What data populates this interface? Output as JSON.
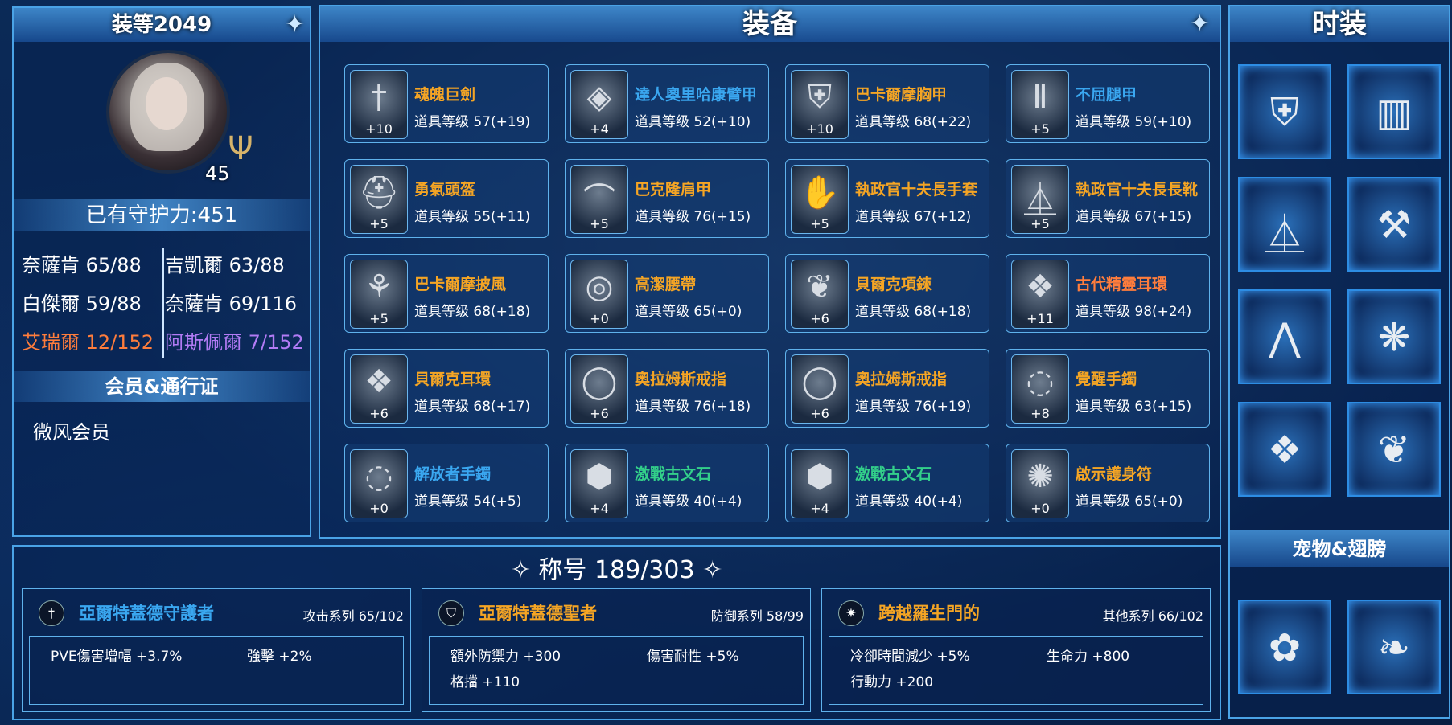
{
  "left": {
    "header": "装等2049",
    "level": "45",
    "guard": "已有守护力:451",
    "stats": [
      {
        "label": "奈薩肯 65/88",
        "color": "#ffffff"
      },
      {
        "label": "吉凱爾 63/88",
        "color": "#ffffff"
      },
      {
        "label": "白傑爾 59/88",
        "color": "#ffffff"
      },
      {
        "label": "奈薩肯 69/116",
        "color": "#ffffff"
      },
      {
        "label": "艾瑞爾 12/152",
        "color": "#ff7d3c"
      },
      {
        "label": "阿斯佩爾 7/152",
        "color": "#b27bf5"
      }
    ],
    "member_header": "会员&通行证",
    "member": "微风会员"
  },
  "equip": {
    "header": "装备",
    "items": [
      {
        "name": "魂魄巨劍",
        "level": "道具等级 57(+19)",
        "plus": "+10",
        "icon": "sword-icon",
        "color": "#f5a524"
      },
      {
        "name": "達人奧里哈康臂甲",
        "level": "道具等级 52(+10)",
        "plus": "+4",
        "icon": "vambrace-icon",
        "color": "#3aa7f0"
      },
      {
        "name": "巴卡爾摩胸甲",
        "level": "道具等级 68(+22)",
        "plus": "+10",
        "icon": "chest-armor-icon",
        "color": "#f5a524"
      },
      {
        "name": "不屈腿甲",
        "level": "道具等级 59(+10)",
        "plus": "+5",
        "icon": "leg-armor-icon",
        "color": "#3aa7f0"
      },
      {
        "name": "勇氣頭盔",
        "level": "道具等级 55(+11)",
        "plus": "+5",
        "icon": "helmet-icon",
        "color": "#f5a524"
      },
      {
        "name": "巴克隆肩甲",
        "level": "道具等级 76(+15)",
        "plus": "+5",
        "icon": "shoulder-icon",
        "color": "#f5a524"
      },
      {
        "name": "執政官十夫長手套",
        "level": "道具等级 67(+12)",
        "plus": "+5",
        "icon": "gloves-icon",
        "color": "#f5a524"
      },
      {
        "name": "執政官十夫長長靴",
        "level": "道具等级 67(+15)",
        "plus": "+5",
        "icon": "boots-icon",
        "color": "#f5a524"
      },
      {
        "name": "巴卡爾摩披風",
        "level": "道具等级 68(+18)",
        "plus": "+5",
        "icon": "cape-icon",
        "color": "#f5a524"
      },
      {
        "name": "高潔腰帶",
        "level": "道具等级 65(+0)",
        "plus": "+0",
        "icon": "belt-icon",
        "color": "#f5a524"
      },
      {
        "name": "貝爾克項鍊",
        "level": "道具等级 68(+18)",
        "plus": "+6",
        "icon": "necklace-icon",
        "color": "#f5a524"
      },
      {
        "name": "古代精靈耳環",
        "level": "道具等级 98(+24)",
        "plus": "+11",
        "icon": "earring-icon",
        "color": "#ff7d3c"
      },
      {
        "name": "貝爾克耳環",
        "level": "道具等级 68(+17)",
        "plus": "+6",
        "icon": "earring-icon",
        "color": "#f5a524"
      },
      {
        "name": "奧拉姆斯戒指",
        "level": "道具等级 76(+18)",
        "plus": "+6",
        "icon": "ring-icon",
        "color": "#f5a524"
      },
      {
        "name": "奧拉姆斯戒指",
        "level": "道具等级 76(+19)",
        "plus": "+6",
        "icon": "ring-icon",
        "color": "#f5a524"
      },
      {
        "name": "覺醒手鐲",
        "level": "道具等级 63(+15)",
        "plus": "+8",
        "icon": "bracelet-icon",
        "color": "#f5a524"
      },
      {
        "name": "解放者手鐲",
        "level": "道具等级 54(+5)",
        "plus": "+0",
        "icon": "bracelet-icon",
        "color": "#3aa7f0"
      },
      {
        "name": "激戰古文石",
        "level": "道具等级 40(+4)",
        "plus": "+4",
        "icon": "rune-stone-icon",
        "color": "#33d08a"
      },
      {
        "name": "激戰古文石",
        "level": "道具等级 40(+4)",
        "plus": "+4",
        "icon": "rune-stone-icon",
        "color": "#33d08a"
      },
      {
        "name": "啟示護身符",
        "level": "道具等级 65(+0)",
        "plus": "+0",
        "icon": "amulet-icon",
        "color": "#f5a524"
      }
    ]
  },
  "fashion": {
    "header": "时装",
    "items": [
      "top-icon",
      "shorts-icon",
      "boots-icon",
      "weapon-icon",
      "ribbon-icon",
      "feather-icon",
      "earring-icon",
      "necklace-icon"
    ],
    "pet_header": "宠物&翅膀",
    "pets": [
      "pet-icon",
      "wings-icon"
    ]
  },
  "titles": {
    "header": "称号 189/303",
    "cards": [
      {
        "name": "亞爾特蓋德守護者",
        "series": "攻击系列 65/102",
        "color": "#3aa7f0",
        "icon": "sword-icon",
        "effects": [
          "PVE傷害增幅 +3.7%",
          "強擊 +2%"
        ]
      },
      {
        "name": "亞爾特蓋德聖者",
        "series": "防御系列 58/99",
        "color": "#f5a524",
        "icon": "shield-icon",
        "effects": [
          "額外防禦力 +300",
          "傷害耐性 +5%",
          "格擋 +110"
        ]
      },
      {
        "name": "跨越羅生門的",
        "series": "其他系列 66/102",
        "color": "#f5a524",
        "icon": "star-icon",
        "effects": [
          "冷卻時間減少 +5%",
          "生命力 +800",
          "行動力 +200"
        ]
      }
    ]
  }
}
